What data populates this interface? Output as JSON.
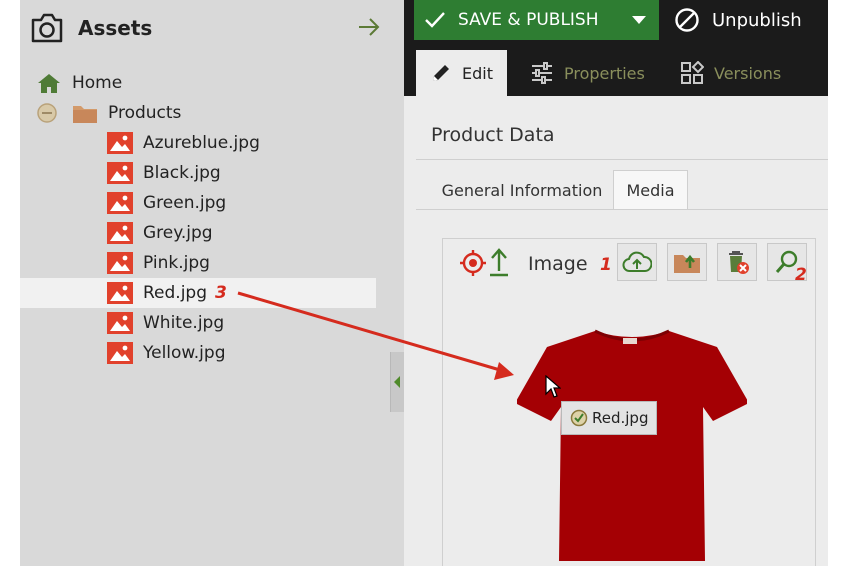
{
  "assets_panel": {
    "title": "Assets",
    "tree": [
      {
        "label": "Home",
        "icon": "home-icon",
        "indent": 0
      },
      {
        "label": "Products",
        "icon": "folder-icon",
        "indent": 0
      },
      {
        "label": "Azureblue.jpg",
        "icon": "image-file-icon",
        "indent": 2
      },
      {
        "label": "Black.jpg",
        "icon": "image-file-icon",
        "indent": 2
      },
      {
        "label": "Green.jpg",
        "icon": "image-file-icon",
        "indent": 2
      },
      {
        "label": "Grey.jpg",
        "icon": "image-file-icon",
        "indent": 2
      },
      {
        "label": "Pink.jpg",
        "icon": "image-file-icon",
        "indent": 2
      },
      {
        "label": "Red.jpg",
        "icon": "image-file-icon",
        "indent": 2
      },
      {
        "label": "White.jpg",
        "icon": "image-file-icon",
        "indent": 2
      },
      {
        "label": "Yellow.jpg",
        "icon": "image-file-icon",
        "indent": 2
      }
    ],
    "selected": "Red.jpg",
    "step_marker": "3"
  },
  "toolbar": {
    "save_label": "SAVE & PUBLISH",
    "unpublish_label": "Unpublish"
  },
  "tabs": [
    {
      "label": "Edit",
      "active": true
    },
    {
      "label": "Properties",
      "active": false
    },
    {
      "label": "Versions",
      "active": false
    }
  ],
  "editor": {
    "section_title": "Product Data",
    "subtabs": [
      {
        "label": "General Information",
        "active": false
      },
      {
        "label": "Media",
        "active": true
      }
    ],
    "image_field": {
      "label": "Image",
      "marker_1": "1",
      "marker_2": "2",
      "drag_label": "Red.jpg"
    }
  },
  "colors": {
    "save_green": "#2e7d32",
    "topbar_dark": "#1b1b1b",
    "panel_grey": "#d9d9d9",
    "marker_red": "#d52b1e",
    "tshirt_red": "#a40004",
    "inactive_tab": "#8a8f5c"
  }
}
